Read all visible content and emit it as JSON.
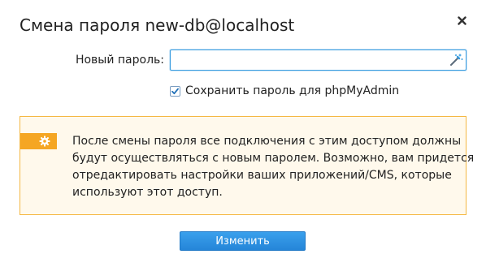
{
  "dialog": {
    "title": "Смена пароля new-db@localhost",
    "close_icon": "close-icon"
  },
  "form": {
    "password_label": "Новый пароль:",
    "password_value": "",
    "password_placeholder": "",
    "generator_icon": "magic-wand-icon",
    "save_checkbox_label": "Сохранить пароль для phpMyAdmin",
    "save_checked": true
  },
  "notice": {
    "icon": "gear-icon",
    "lines": [
      "После смены пароля все подключения с этим доступом должны",
      "будут осуществляться с новым паролем. Возможно, вам придется",
      "отредактировать настройки ваших приложений/CMS, которые",
      "используют этот доступ."
    ]
  },
  "actions": {
    "submit_label": "Изменить"
  },
  "colors": {
    "accent_blue": "#2585d8",
    "notice_border": "#f5b843",
    "notice_background": "#fff9ec",
    "notice_tab": "#f5a623"
  }
}
